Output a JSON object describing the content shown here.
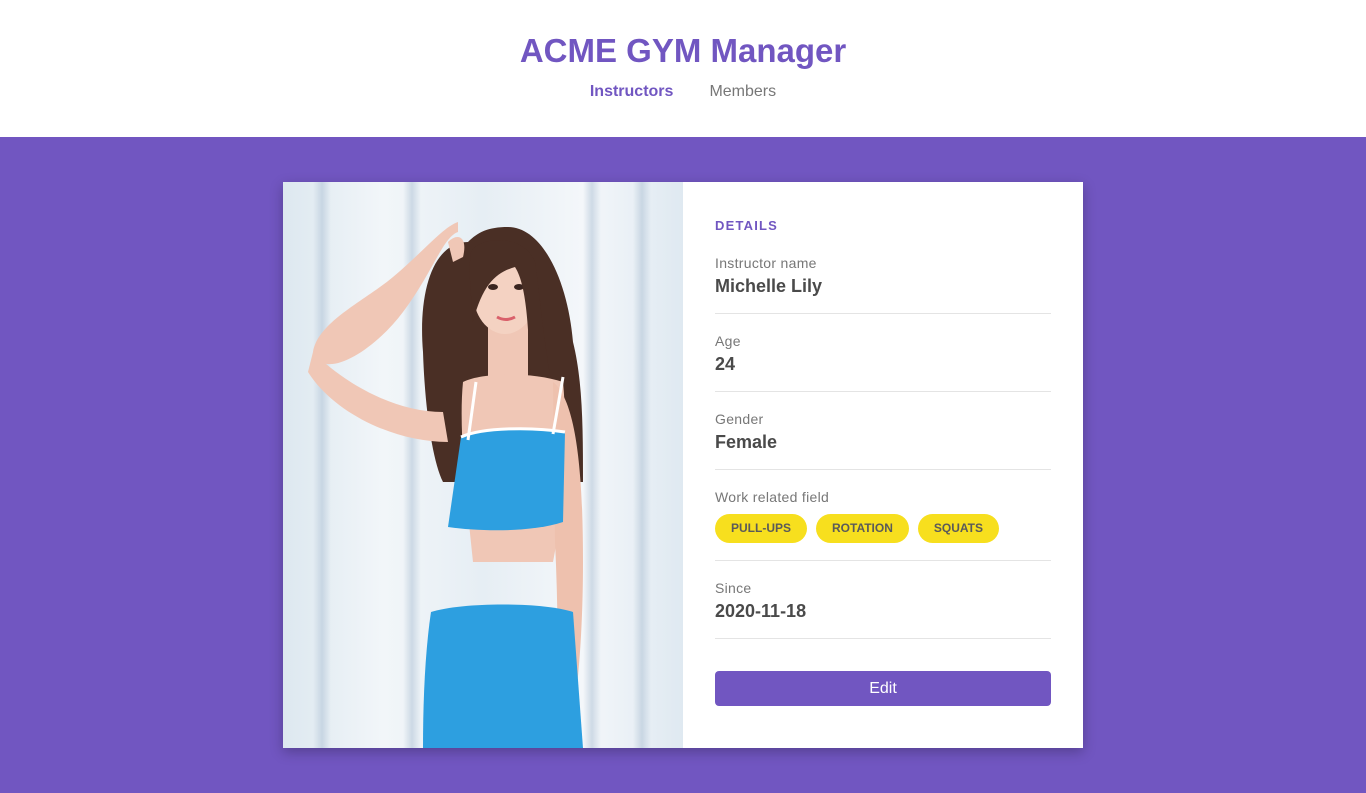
{
  "header": {
    "title": "ACME GYM Manager",
    "nav": [
      {
        "label": "Instructors",
        "active": true
      },
      {
        "label": "Members",
        "active": false
      }
    ]
  },
  "colors": {
    "accent": "#7156c1",
    "tag": "#f7df1e"
  },
  "details": {
    "section_title": "DETAILS",
    "name_label": "Instructor name",
    "name_value": "Michelle Lily",
    "age_label": "Age",
    "age_value": "24",
    "gender_label": "Gender",
    "gender_value": "Female",
    "work_label": "Work related field",
    "tags": [
      "PULL-UPS",
      "ROTATION",
      "SQUATS"
    ],
    "since_label": "Since",
    "since_value": "2020-11-18",
    "edit_label": "Edit"
  }
}
